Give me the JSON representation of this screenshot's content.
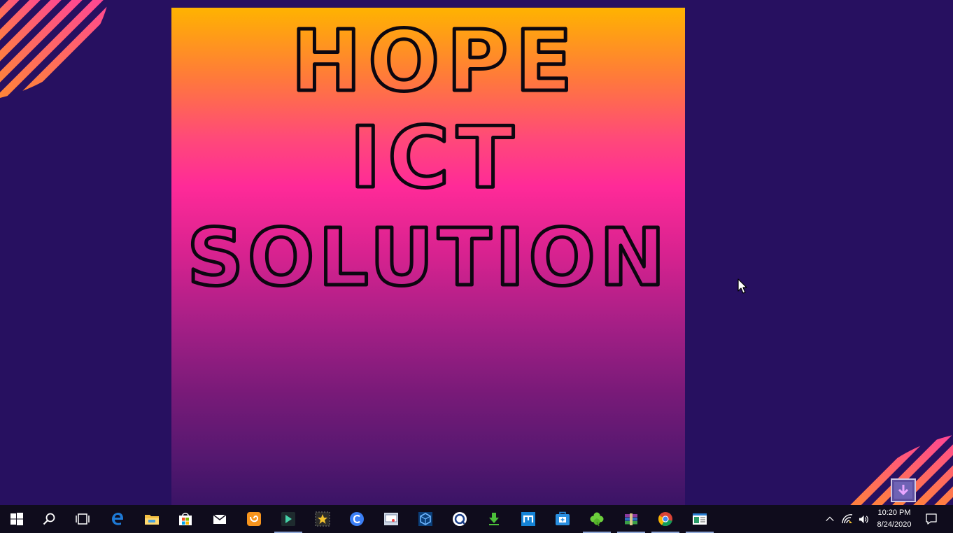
{
  "poster": {
    "line1": "HOPE",
    "line2": "ICT",
    "line3": "SOLUTION"
  },
  "taskbar": {
    "apps": [
      {
        "name": "start-button",
        "icon": "windows-logo-icon"
      },
      {
        "name": "search-button",
        "icon": "search-icon"
      },
      {
        "name": "task-view-button",
        "icon": "task-view-icon"
      },
      {
        "name": "edge-button",
        "icon": "edge-icon"
      },
      {
        "name": "file-explorer-button",
        "icon": "folder-icon"
      },
      {
        "name": "store-button",
        "icon": "store-bag-icon"
      },
      {
        "name": "mail-button",
        "icon": "mail-icon"
      },
      {
        "name": "uc-browser-button",
        "icon": "uc-browser-icon"
      },
      {
        "name": "filmora-button",
        "icon": "filmora-icon"
      },
      {
        "name": "movie-maker-button",
        "icon": "star-film-icon"
      },
      {
        "name": "cortana-c-button",
        "icon": "c-circle-icon"
      },
      {
        "name": "remote-desktop-button",
        "icon": "monitor-icon"
      },
      {
        "name": "vpn-shield-button",
        "icon": "cube-shield-icon"
      },
      {
        "name": "qq-player-button",
        "icon": "q-player-icon"
      },
      {
        "name": "downloader-button",
        "icon": "download-arrow-icon"
      },
      {
        "name": "maxthon-button",
        "icon": "m-square-icon"
      },
      {
        "name": "toolbox-button",
        "icon": "toolbox-icon"
      },
      {
        "name": "clover-button",
        "icon": "clover-icon"
      },
      {
        "name": "winrar-button",
        "icon": "archive-books-icon"
      },
      {
        "name": "chrome-button",
        "icon": "chrome-icon"
      },
      {
        "name": "notepad-button",
        "icon": "document-window-icon"
      }
    ]
  },
  "tray": {
    "time": "10:20 PM",
    "date": "8/24/2020",
    "icons": [
      "chevron-up-icon",
      "wifi-icon",
      "volume-icon",
      "notification-icon"
    ]
  },
  "colors": {
    "desktop_bg": "#271060",
    "taskbar_bg": "#0f0c1c",
    "poster_top": "#ffb300",
    "poster_mid": "#ff2a98",
    "poster_bottom": "#3a1466",
    "deco_pink": "#ff3f9e",
    "deco_orange": "#ff8a30"
  }
}
